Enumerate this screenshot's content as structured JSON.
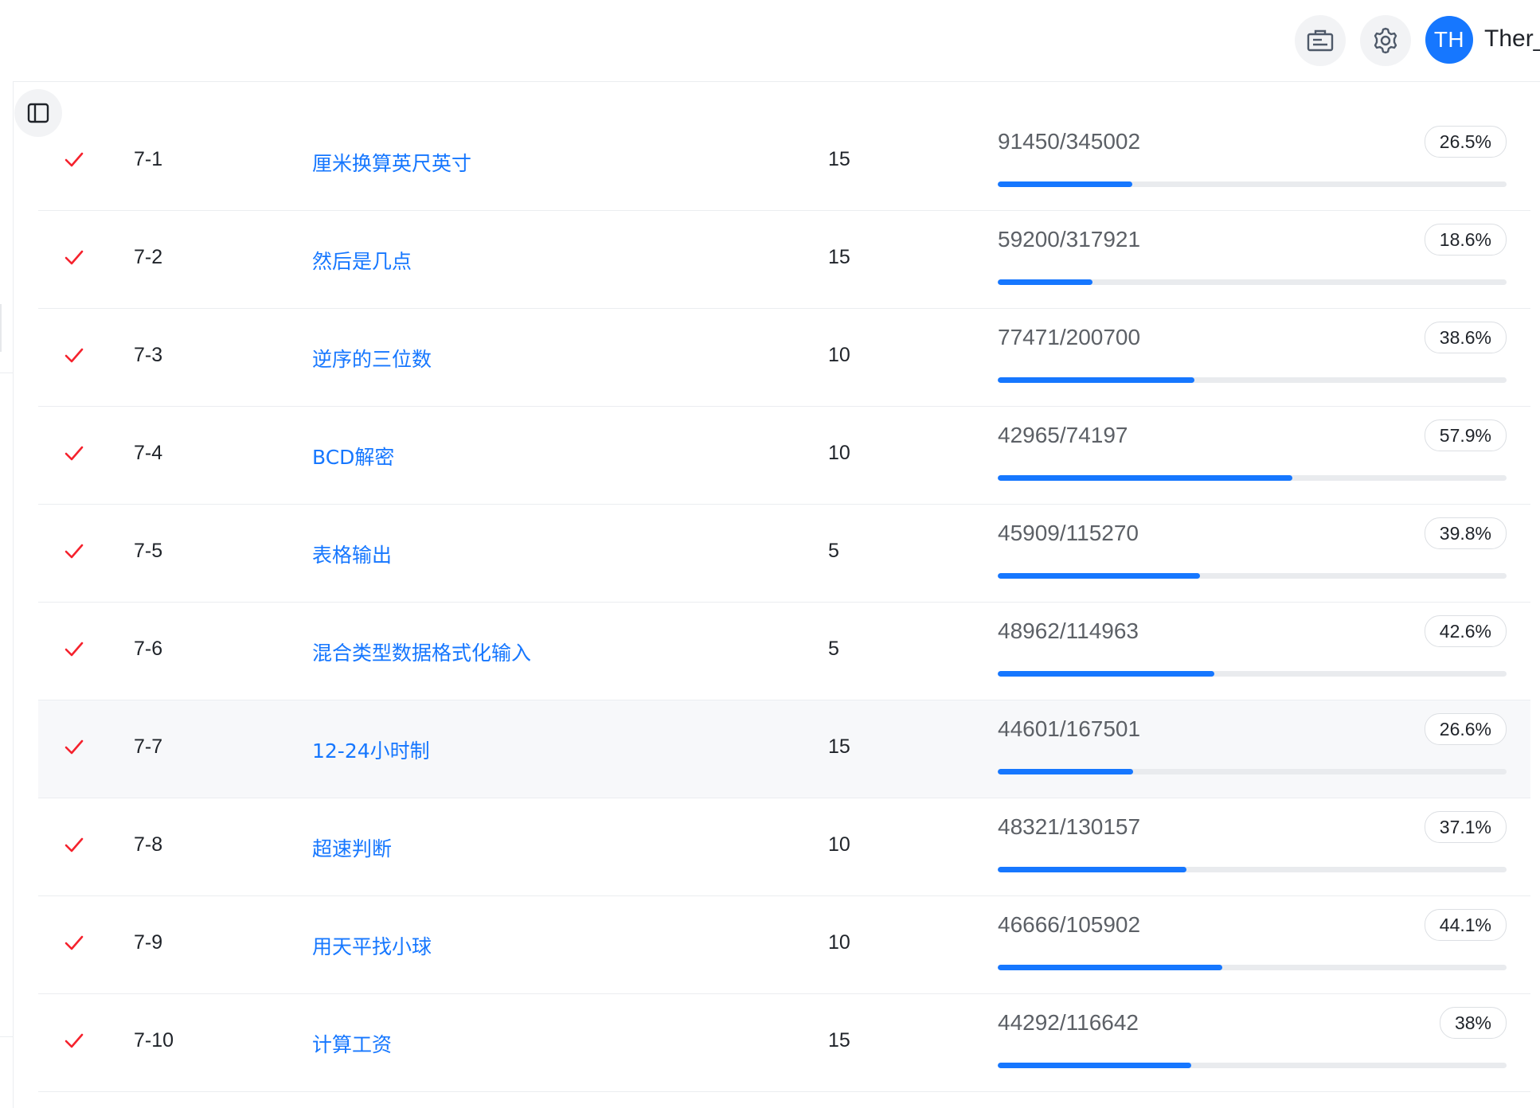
{
  "header": {
    "avatar_initials": "TH",
    "username": "Ther_",
    "ticket_icon": "ticket-icon",
    "settings_icon": "gear-icon"
  },
  "sidebar": {
    "toggle_icon": "sidebar-toggle-icon"
  },
  "colors": {
    "accent": "#1677ff",
    "check": "#f5222d",
    "track": "#e9ebee",
    "divider": "#ebedf0"
  },
  "problems": [
    {
      "id": "7-1",
      "title": "厘米换算英尺英寸",
      "score": "15",
      "ratio": "91450/345002",
      "percent": "26.5%",
      "rate": 0.265
    },
    {
      "id": "7-2",
      "title": "然后是几点",
      "score": "15",
      "ratio": "59200/317921",
      "percent": "18.6%",
      "rate": 0.186
    },
    {
      "id": "7-3",
      "title": "逆序的三位数",
      "score": "10",
      "ratio": "77471/200700",
      "percent": "38.6%",
      "rate": 0.386
    },
    {
      "id": "7-4",
      "title": "BCD解密",
      "score": "10",
      "ratio": "42965/74197",
      "percent": "57.9%",
      "rate": 0.579
    },
    {
      "id": "7-5",
      "title": "表格输出",
      "score": "5",
      "ratio": "45909/115270",
      "percent": "39.8%",
      "rate": 0.398
    },
    {
      "id": "7-6",
      "title": "混合类型数据格式化输入",
      "score": "5",
      "ratio": "48962/114963",
      "percent": "42.6%",
      "rate": 0.426
    },
    {
      "id": "7-7",
      "title": "12-24小时制",
      "score": "15",
      "ratio": "44601/167501",
      "percent": "26.6%",
      "rate": 0.266
    },
    {
      "id": "7-8",
      "title": "超速判断",
      "score": "10",
      "ratio": "48321/130157",
      "percent": "37.1%",
      "rate": 0.371
    },
    {
      "id": "7-9",
      "title": "用天平找小球",
      "score": "10",
      "ratio": "46666/105902",
      "percent": "44.1%",
      "rate": 0.441
    },
    {
      "id": "7-10",
      "title": "计算工资",
      "score": "15",
      "ratio": "44292/116642",
      "percent": "38%",
      "rate": 0.38
    }
  ]
}
